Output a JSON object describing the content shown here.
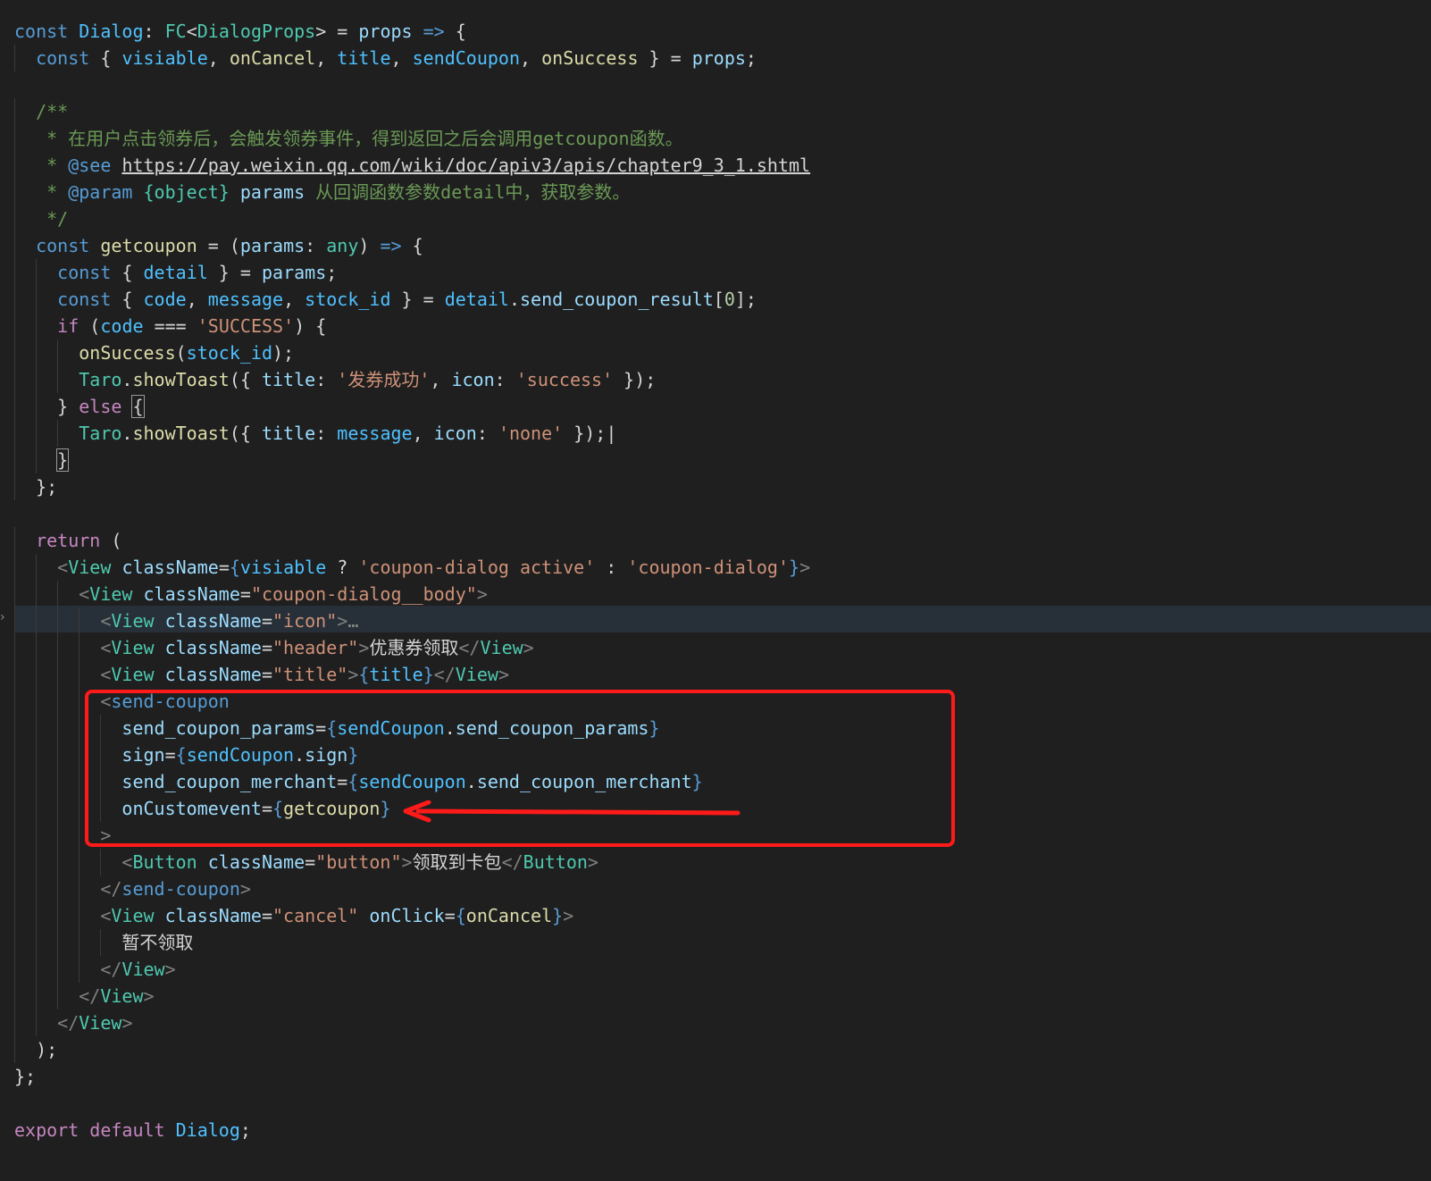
{
  "colors": {
    "background": "#1f1f1f",
    "current_line_bg": "#273038",
    "annotation_red": "#ff1a1a",
    "keyword_blue": "#569cd6",
    "variable_lightblue": "#9cdcfe",
    "type_teal": "#4ec9b0",
    "function_yellow": "#dcdcaa",
    "string_orange": "#ce9178",
    "comment_green": "#6a9955",
    "control_purple": "#c586c0",
    "constant_blue": "#4fc1ff",
    "number_green": "#b5cea8",
    "punctuation_grey": "#808080",
    "plain": "#d4d4d4"
  },
  "annotations": {
    "highlight_box": "rectangle around the <send-coupon> element",
    "arrow": "arrow pointing to onCustomevent={getcoupon}",
    "arrow_icon": "left-arrow-icon"
  },
  "code_lines": [
    [
      [
        "const",
        "#569cd6"
      ],
      [
        " ",
        "#d4d4d4"
      ],
      [
        "Dialog",
        "#4fc1ff"
      ],
      [
        ": ",
        "#d4d4d4"
      ],
      [
        "FC",
        "#4ec9b0"
      ],
      [
        "<",
        "#d4d4d4"
      ],
      [
        "DialogProps",
        "#4ec9b0"
      ],
      [
        "> = ",
        "#d4d4d4"
      ],
      [
        "props",
        "#9cdcfe"
      ],
      [
        " ",
        "#d4d4d4"
      ],
      [
        "=>",
        "#569cd6"
      ],
      [
        " {",
        "#d4d4d4"
      ]
    ],
    [
      [
        "  ",
        "#d4d4d4"
      ],
      [
        "const",
        "#569cd6"
      ],
      [
        " { ",
        "#d4d4d4"
      ],
      [
        "visiable",
        "#4fc1ff"
      ],
      [
        ", ",
        "#d4d4d4"
      ],
      [
        "onCancel",
        "#dcdcaa"
      ],
      [
        ", ",
        "#d4d4d4"
      ],
      [
        "title",
        "#4fc1ff"
      ],
      [
        ", ",
        "#d4d4d4"
      ],
      [
        "sendCoupon",
        "#4fc1ff"
      ],
      [
        ", ",
        "#d4d4d4"
      ],
      [
        "onSuccess",
        "#dcdcaa"
      ],
      [
        " } = ",
        "#d4d4d4"
      ],
      [
        "props",
        "#9cdcfe"
      ],
      [
        ";",
        "#d4d4d4"
      ]
    ],
    [],
    [
      [
        "  ",
        "#d4d4d4"
      ],
      [
        "/**",
        "#6a9955"
      ]
    ],
    [
      [
        "   ",
        "#d4d4d4"
      ],
      [
        "* 在用户点击领券后，会触发领券事件，得到返回之后会调用getcoupon函数。",
        "#6a9955"
      ]
    ],
    [
      [
        "   ",
        "#d4d4d4"
      ],
      [
        "* ",
        "#6a9955"
      ],
      [
        "@see",
        "#569cd6"
      ],
      [
        " ",
        "#6a9955"
      ],
      [
        "https://pay.weixin.qq.com/wiki/doc/apiv3/apis/chapter9_3_1.shtml",
        "#d4d4d4",
        "underline"
      ]
    ],
    [
      [
        "   ",
        "#d4d4d4"
      ],
      [
        "* ",
        "#6a9955"
      ],
      [
        "@param",
        "#569cd6"
      ],
      [
        " ",
        "#6a9955"
      ],
      [
        "{object}",
        "#4ec9b0"
      ],
      [
        " ",
        "#6a9955"
      ],
      [
        "params",
        "#9cdcfe"
      ],
      [
        " 从回调函数参数detail中，获取参数。",
        "#6a9955"
      ]
    ],
    [
      [
        "   ",
        "#d4d4d4"
      ],
      [
        "*/",
        "#6a9955"
      ]
    ],
    [
      [
        "  ",
        "#d4d4d4"
      ],
      [
        "const",
        "#569cd6"
      ],
      [
        " ",
        "#d4d4d4"
      ],
      [
        "getcoupon",
        "#dcdcaa"
      ],
      [
        " = (",
        "#d4d4d4"
      ],
      [
        "params",
        "#9cdcfe"
      ],
      [
        ": ",
        "#d4d4d4"
      ],
      [
        "any",
        "#4ec9b0"
      ],
      [
        ") ",
        "#d4d4d4"
      ],
      [
        "=>",
        "#569cd6"
      ],
      [
        " {",
        "#d4d4d4"
      ]
    ],
    [
      [
        "    ",
        "#d4d4d4"
      ],
      [
        "const",
        "#569cd6"
      ],
      [
        " { ",
        "#d4d4d4"
      ],
      [
        "detail",
        "#4fc1ff"
      ],
      [
        " } = ",
        "#d4d4d4"
      ],
      [
        "params",
        "#9cdcfe"
      ],
      [
        ";",
        "#d4d4d4"
      ]
    ],
    [
      [
        "    ",
        "#d4d4d4"
      ],
      [
        "const",
        "#569cd6"
      ],
      [
        " { ",
        "#d4d4d4"
      ],
      [
        "code",
        "#4fc1ff"
      ],
      [
        ", ",
        "#d4d4d4"
      ],
      [
        "message",
        "#4fc1ff"
      ],
      [
        ", ",
        "#d4d4d4"
      ],
      [
        "stock_id",
        "#4fc1ff"
      ],
      [
        " } = ",
        "#d4d4d4"
      ],
      [
        "detail",
        "#4fc1ff"
      ],
      [
        ".",
        "#d4d4d4"
      ],
      [
        "send_coupon_result",
        "#9cdcfe"
      ],
      [
        "[",
        "#d4d4d4"
      ],
      [
        "0",
        "#b5cea8"
      ],
      [
        "];",
        "#d4d4d4"
      ]
    ],
    [
      [
        "    ",
        "#d4d4d4"
      ],
      [
        "if",
        "#c586c0"
      ],
      [
        " (",
        "#d4d4d4"
      ],
      [
        "code",
        "#4fc1ff"
      ],
      [
        " === ",
        "#d4d4d4"
      ],
      [
        "'SUCCESS'",
        "#ce9178"
      ],
      [
        ") {",
        "#d4d4d4"
      ]
    ],
    [
      [
        "      ",
        "#d4d4d4"
      ],
      [
        "onSuccess",
        "#dcdcaa"
      ],
      [
        "(",
        "#d4d4d4"
      ],
      [
        "stock_id",
        "#4fc1ff"
      ],
      [
        ");",
        "#d4d4d4"
      ]
    ],
    [
      [
        "      ",
        "#d4d4d4"
      ],
      [
        "Taro",
        "#4ec9b0"
      ],
      [
        ".",
        "#d4d4d4"
      ],
      [
        "showToast",
        "#dcdcaa"
      ],
      [
        "({ ",
        "#d4d4d4"
      ],
      [
        "title",
        "#9cdcfe"
      ],
      [
        ": ",
        "#d4d4d4"
      ],
      [
        "'发券成功'",
        "#ce9178"
      ],
      [
        ", ",
        "#d4d4d4"
      ],
      [
        "icon",
        "#9cdcfe"
      ],
      [
        ": ",
        "#d4d4d4"
      ],
      [
        "'success'",
        "#ce9178"
      ],
      [
        " });",
        "#d4d4d4"
      ]
    ],
    [
      [
        "    ",
        "#d4d4d4"
      ],
      [
        "} ",
        "#d4d4d4"
      ],
      [
        "else",
        "#c586c0"
      ],
      [
        " ",
        "#d4d4d4"
      ],
      [
        "{",
        "#d4d4d4",
        "box"
      ]
    ],
    [
      [
        "      ",
        "#d4d4d4"
      ],
      [
        "Taro",
        "#4ec9b0"
      ],
      [
        ".",
        "#d4d4d4"
      ],
      [
        "showToast",
        "#dcdcaa"
      ],
      [
        "({ ",
        "#d4d4d4"
      ],
      [
        "title",
        "#9cdcfe"
      ],
      [
        ": ",
        "#d4d4d4"
      ],
      [
        "message",
        "#4fc1ff"
      ],
      [
        ", ",
        "#d4d4d4"
      ],
      [
        "icon",
        "#9cdcfe"
      ],
      [
        ": ",
        "#d4d4d4"
      ],
      [
        "'none'",
        "#ce9178"
      ],
      [
        " });",
        "#d4d4d4"
      ],
      [
        "|",
        "#d4d4d4"
      ]
    ],
    [
      [
        "    ",
        "#d4d4d4"
      ],
      [
        "}",
        "#d4d4d4",
        "box"
      ]
    ],
    [
      [
        "  ",
        "#d4d4d4"
      ],
      [
        "};",
        "#d4d4d4"
      ]
    ],
    [],
    [
      [
        "  ",
        "#d4d4d4"
      ],
      [
        "return",
        "#c586c0"
      ],
      [
        " (",
        "#d4d4d4"
      ]
    ],
    [
      [
        "    ",
        "#d4d4d4"
      ],
      [
        "<",
        "#808080"
      ],
      [
        "View",
        "#4ec9b0"
      ],
      [
        " ",
        "#d4d4d4"
      ],
      [
        "className",
        "#9cdcfe"
      ],
      [
        "=",
        "#d4d4d4"
      ],
      [
        "{",
        "#569cd6"
      ],
      [
        "visiable",
        "#4fc1ff"
      ],
      [
        " ? ",
        "#d4d4d4"
      ],
      [
        "'coupon-dialog active'",
        "#ce9178"
      ],
      [
        " : ",
        "#d4d4d4"
      ],
      [
        "'coupon-dialog'",
        "#ce9178"
      ],
      [
        "}",
        "#569cd6"
      ],
      [
        ">",
        "#808080"
      ]
    ],
    [
      [
        "      ",
        "#d4d4d4"
      ],
      [
        "<",
        "#808080"
      ],
      [
        "View",
        "#4ec9b0"
      ],
      [
        " ",
        "#d4d4d4"
      ],
      [
        "className",
        "#9cdcfe"
      ],
      [
        "=",
        "#d4d4d4"
      ],
      [
        "\"coupon-dialog__body\"",
        "#ce9178"
      ],
      [
        ">",
        "#808080"
      ]
    ],
    [
      [
        "        ",
        "#d4d4d4"
      ],
      [
        "<",
        "#808080"
      ],
      [
        "View",
        "#4ec9b0"
      ],
      [
        " ",
        "#d4d4d4"
      ],
      [
        "className",
        "#9cdcfe"
      ],
      [
        "=",
        "#d4d4d4"
      ],
      [
        "\"icon\"",
        "#ce9178"
      ],
      [
        ">",
        "#808080"
      ],
      [
        "…",
        "#8c8c8c"
      ]
    ],
    [
      [
        "        ",
        "#d4d4d4"
      ],
      [
        "<",
        "#808080"
      ],
      [
        "View",
        "#4ec9b0"
      ],
      [
        " ",
        "#d4d4d4"
      ],
      [
        "className",
        "#9cdcfe"
      ],
      [
        "=",
        "#d4d4d4"
      ],
      [
        "\"header\"",
        "#ce9178"
      ],
      [
        ">",
        "#808080"
      ],
      [
        "优惠券领取",
        "#d4d4d4"
      ],
      [
        "</",
        "#808080"
      ],
      [
        "View",
        "#4ec9b0"
      ],
      [
        ">",
        "#808080"
      ]
    ],
    [
      [
        "        ",
        "#d4d4d4"
      ],
      [
        "<",
        "#808080"
      ],
      [
        "View",
        "#4ec9b0"
      ],
      [
        " ",
        "#d4d4d4"
      ],
      [
        "className",
        "#9cdcfe"
      ],
      [
        "=",
        "#d4d4d4"
      ],
      [
        "\"title\"",
        "#ce9178"
      ],
      [
        ">",
        "#808080"
      ],
      [
        "{",
        "#569cd6"
      ],
      [
        "title",
        "#4fc1ff"
      ],
      [
        "}",
        "#569cd6"
      ],
      [
        "</",
        "#808080"
      ],
      [
        "View",
        "#4ec9b0"
      ],
      [
        ">",
        "#808080"
      ]
    ],
    [
      [
        "        ",
        "#d4d4d4"
      ],
      [
        "<",
        "#808080"
      ],
      [
        "send-coupon",
        "#569cd6"
      ]
    ],
    [
      [
        "          ",
        "#d4d4d4"
      ],
      [
        "send_coupon_params",
        "#9cdcfe"
      ],
      [
        "=",
        "#d4d4d4"
      ],
      [
        "{",
        "#569cd6"
      ],
      [
        "sendCoupon",
        "#4fc1ff"
      ],
      [
        ".",
        "#d4d4d4"
      ],
      [
        "send_coupon_params",
        "#9cdcfe"
      ],
      [
        "}",
        "#569cd6"
      ]
    ],
    [
      [
        "          ",
        "#d4d4d4"
      ],
      [
        "sign",
        "#9cdcfe"
      ],
      [
        "=",
        "#d4d4d4"
      ],
      [
        "{",
        "#569cd6"
      ],
      [
        "sendCoupon",
        "#4fc1ff"
      ],
      [
        ".",
        "#d4d4d4"
      ],
      [
        "sign",
        "#9cdcfe"
      ],
      [
        "}",
        "#569cd6"
      ]
    ],
    [
      [
        "          ",
        "#d4d4d4"
      ],
      [
        "send_coupon_merchant",
        "#9cdcfe"
      ],
      [
        "=",
        "#d4d4d4"
      ],
      [
        "{",
        "#569cd6"
      ],
      [
        "sendCoupon",
        "#4fc1ff"
      ],
      [
        ".",
        "#d4d4d4"
      ],
      [
        "send_coupon_merchant",
        "#9cdcfe"
      ],
      [
        "}",
        "#569cd6"
      ]
    ],
    [
      [
        "          ",
        "#d4d4d4"
      ],
      [
        "onCustomevent",
        "#9cdcfe"
      ],
      [
        "=",
        "#d4d4d4"
      ],
      [
        "{",
        "#569cd6"
      ],
      [
        "getcoupon",
        "#dcdcaa"
      ],
      [
        "}",
        "#569cd6"
      ]
    ],
    [
      [
        "        ",
        "#d4d4d4"
      ],
      [
        ">",
        "#808080"
      ]
    ],
    [
      [
        "          ",
        "#d4d4d4"
      ],
      [
        "<",
        "#808080"
      ],
      [
        "Button",
        "#4ec9b0"
      ],
      [
        " ",
        "#d4d4d4"
      ],
      [
        "className",
        "#9cdcfe"
      ],
      [
        "=",
        "#d4d4d4"
      ],
      [
        "\"button\"",
        "#ce9178"
      ],
      [
        ">",
        "#808080"
      ],
      [
        "领取到卡包",
        "#d4d4d4"
      ],
      [
        "</",
        "#808080"
      ],
      [
        "Button",
        "#4ec9b0"
      ],
      [
        ">",
        "#808080"
      ]
    ],
    [
      [
        "        ",
        "#d4d4d4"
      ],
      [
        "</",
        "#808080"
      ],
      [
        "send-coupon",
        "#569cd6"
      ],
      [
        ">",
        "#808080"
      ]
    ],
    [
      [
        "        ",
        "#d4d4d4"
      ],
      [
        "<",
        "#808080"
      ],
      [
        "View",
        "#4ec9b0"
      ],
      [
        " ",
        "#d4d4d4"
      ],
      [
        "className",
        "#9cdcfe"
      ],
      [
        "=",
        "#d4d4d4"
      ],
      [
        "\"cancel\"",
        "#ce9178"
      ],
      [
        " ",
        "#d4d4d4"
      ],
      [
        "onClick",
        "#9cdcfe"
      ],
      [
        "=",
        "#d4d4d4"
      ],
      [
        "{",
        "#569cd6"
      ],
      [
        "onCancel",
        "#dcdcaa"
      ],
      [
        "}",
        "#569cd6"
      ],
      [
        ">",
        "#808080"
      ]
    ],
    [
      [
        "          ",
        "#d4d4d4"
      ],
      [
        "暂不领取",
        "#d4d4d4"
      ]
    ],
    [
      [
        "        ",
        "#d4d4d4"
      ],
      [
        "</",
        "#808080"
      ],
      [
        "View",
        "#4ec9b0"
      ],
      [
        ">",
        "#808080"
      ]
    ],
    [
      [
        "      ",
        "#d4d4d4"
      ],
      [
        "</",
        "#808080"
      ],
      [
        "View",
        "#4ec9b0"
      ],
      [
        ">",
        "#808080"
      ]
    ],
    [
      [
        "    ",
        "#d4d4d4"
      ],
      [
        "</",
        "#808080"
      ],
      [
        "View",
        "#4ec9b0"
      ],
      [
        ">",
        "#808080"
      ]
    ],
    [
      [
        "  ",
        "#d4d4d4"
      ],
      [
        ");",
        "#d4d4d4"
      ]
    ],
    [
      [
        "};",
        "#d4d4d4"
      ]
    ],
    [],
    [
      [
        "export",
        "#c586c0"
      ],
      [
        " ",
        "#d4d4d4"
      ],
      [
        "default",
        "#c586c0"
      ],
      [
        " ",
        "#d4d4d4"
      ],
      [
        "Dialog",
        "#4fc1ff"
      ],
      [
        ";",
        "#d4d4d4"
      ]
    ]
  ]
}
